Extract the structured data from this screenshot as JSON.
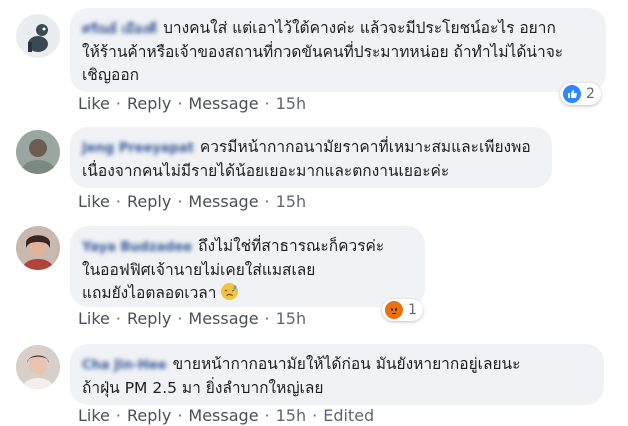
{
  "comments": [
    {
      "author": "ศรัณย์ เมืองดี",
      "lines": [
        "บางคนใส่ แต่เอาไว้ใต้คางค่ะ แล้วจะมีประโยชน์อะไร อยาก",
        "ให้ร้านค้าหรือเจ้าของสถานที่กวดขันคนที่ประมาทหน่อย ถ้าทำไม่ได้น่าจะ",
        "เชิญออก"
      ],
      "actions": {
        "like": "Like",
        "reply": "Reply",
        "message": "Message",
        "time": "15h"
      },
      "reaction": {
        "icon": "like-icon",
        "count": "2"
      }
    },
    {
      "author": "Jeng Preeyapat",
      "lines": [
        "ควรมีหน้ากากอนามัยราคาที่เหมาะสมและเพียงพอ",
        "เนื่องจากคนไม่มีรายได้น้อยเยอะมากและตกงานเยอะค่ะ"
      ],
      "actions": {
        "like": "Like",
        "reply": "Reply",
        "message": "Message",
        "time": "15h"
      }
    },
    {
      "author": "Yaya Budzadee",
      "lines": [
        "ถึงไม่ใช่ที่สาธารณะก็ควรค่ะ",
        "ในออฟฟิศเจ้านายไม่เคยใส่แมสเลย",
        "แถมยังไอตลอดเวลา"
      ],
      "emoji": "downcast-face-emoji",
      "actions": {
        "like": "Like",
        "reply": "Reply",
        "message": "Message",
        "time": "15h"
      },
      "reaction": {
        "icon": "angry-icon",
        "count": "1"
      }
    },
    {
      "author": "Cha Jin-Hee",
      "lines": [
        "ขายหน้ากากอนามัยให้ได้ก่อน มันยังหายากอยู่เลยนะ",
        "ถ้าฝุ่น PM 2.5 มา ยิ่งลำบากใหญ่เลย"
      ],
      "actions": {
        "like": "Like",
        "reply": "Reply",
        "message": "Message",
        "time": "15h",
        "edited": "Edited"
      }
    }
  ],
  "colors": {
    "link": "#385898",
    "bubble": "#f0f2f5",
    "like": "#2d88ff",
    "angry": "#e9710f"
  }
}
